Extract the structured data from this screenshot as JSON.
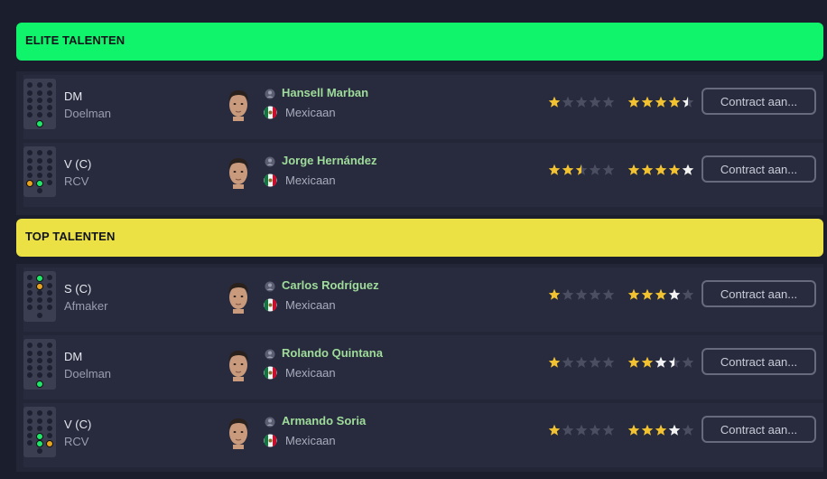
{
  "colors": {
    "elite_header": "#0ff46a",
    "top_header": "#ebe144",
    "star_gold": "#f2c230",
    "star_white": "#f2f2f2",
    "star_empty": "#4a4e60",
    "dot_green": "#1ee86a",
    "dot_orange": "#e8a41e",
    "name_green": "#9fdc9a"
  },
  "sections": [
    {
      "title": "ELITE TALENTEN",
      "players": [
        {
          "role": "DM",
          "role_sub": "Doelman",
          "name": "Hansell Marban",
          "nationality": "Mexicaan",
          "pitch_dots": [
            {
              "slot": "gk",
              "color": "green"
            }
          ],
          "current_stars": 1.0,
          "potential_stars": 4.0,
          "potential_stars_white": 0.5,
          "button": "Contract aan..."
        },
        {
          "role": "V (C)",
          "role_sub": "RCV",
          "name": "Jorge Hernández",
          "nationality": "Mexicaan",
          "pitch_dots": [
            {
              "slot": "dl",
              "color": "orange"
            },
            {
              "slot": "dc",
              "color": "green"
            }
          ],
          "current_stars": 2.5,
          "potential_stars": 4.0,
          "potential_stars_white": 1.0,
          "button": "Contract aan..."
        }
      ]
    },
    {
      "title": "TOP TALENTEN",
      "players": [
        {
          "role": "S (C)",
          "role_sub": "Afmaker",
          "name": "Carlos Rodríguez",
          "nationality": "Mexicaan",
          "pitch_dots": [
            {
              "slot": "st",
              "color": "green"
            },
            {
              "slot": "amc",
              "color": "orange"
            }
          ],
          "current_stars": 1.0,
          "potential_stars": 3.0,
          "potential_stars_white": 1.0,
          "button": "Contract aan..."
        },
        {
          "role": "DM",
          "role_sub": "Doelman",
          "name": "Rolando Quintana",
          "nationality": "Mexicaan",
          "pitch_dots": [
            {
              "slot": "gk",
              "color": "green"
            }
          ],
          "current_stars": 1.0,
          "potential_stars": 2.0,
          "potential_stars_white": 1.5,
          "button": "Contract aan..."
        },
        {
          "role": "V (C)",
          "role_sub": "RCV",
          "name": "Armando Soria",
          "nationality": "Mexicaan",
          "pitch_dots": [
            {
              "slot": "dmc",
              "color": "green"
            },
            {
              "slot": "dc",
              "color": "green"
            },
            {
              "slot": "dcr",
              "color": "orange"
            }
          ],
          "current_stars": 1.0,
          "potential_stars": 3.0,
          "potential_stars_white": 1.0,
          "button": "Contract aan..."
        }
      ]
    }
  ]
}
